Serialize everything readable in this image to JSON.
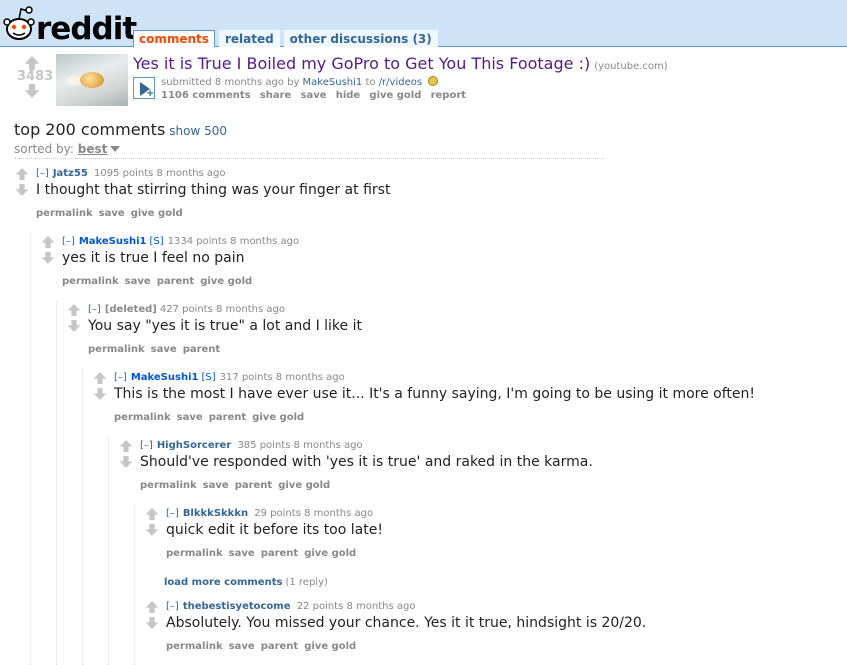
{
  "header": {
    "logo_text": "reddit",
    "tabs": [
      {
        "label": "comments",
        "selected": true
      },
      {
        "label": "related",
        "selected": false
      },
      {
        "label": "other discussions (3)",
        "selected": false
      }
    ]
  },
  "link": {
    "score": "3483",
    "title": "Yes it is True I Boiled my GoPro to Get You This Footage :)",
    "domain": "(youtube.com)",
    "submitted_prefix": "submitted 8 months ago by",
    "author": "MakeSushi1",
    "to": "to",
    "subreddit": "/r/videos",
    "buttons": [
      "1106 comments",
      "share",
      "save",
      "hide",
      "give gold",
      "report"
    ]
  },
  "comment_area": {
    "title": "top 200 comments",
    "show_more": "show 500",
    "sorted_label": "sorted by:",
    "sort_value": "best"
  },
  "comments": [
    {
      "author": "Jatz55",
      "flag": "",
      "score": "1095 points",
      "time": "8 months ago",
      "body": "I thought that stirring thing was your finger at first",
      "buttons": [
        "permalink",
        "save",
        "give gold"
      ]
    },
    {
      "author": "MakeSushi1",
      "flag": "[S]",
      "score": "1334 points",
      "time": "8 months ago",
      "body": "yes it is true I feel no pain",
      "buttons": [
        "permalink",
        "save",
        "parent",
        "give gold"
      ]
    },
    {
      "author": "[deleted]",
      "flag": "",
      "score": "427 points",
      "time": "8 months ago",
      "body": "You say \"yes it is true\" a lot and I like it",
      "buttons": [
        "permalink",
        "save",
        "parent"
      ]
    },
    {
      "author": "MakeSushi1",
      "flag": "[S]",
      "score": "317 points",
      "time": "8 months ago",
      "body": "This is the most I have ever use it... It's a funny saying, I'm going to be using it more often!",
      "buttons": [
        "permalink",
        "save",
        "parent",
        "give gold"
      ]
    },
    {
      "author": "HighSorcerer",
      "flag": "",
      "score": "385 points",
      "time": "8 months ago",
      "body": "Should've responded with 'yes it is true' and raked in the karma.",
      "buttons": [
        "permalink",
        "save",
        "parent",
        "give gold"
      ]
    },
    {
      "author": "BlkkkSkkkn",
      "flag": "",
      "score": "29 points",
      "time": "8 months ago",
      "body": "quick edit it before its too late!",
      "buttons": [
        "permalink",
        "save",
        "parent",
        "give gold"
      ]
    },
    {
      "author": "thebestisyetocome",
      "flag": "",
      "score": "22 points",
      "time": "8 months ago",
      "body": "Absolutely. You missed your chance. Yes it it true, hindsight is 20/20.",
      "buttons": [
        "permalink",
        "save",
        "parent",
        "give gold"
      ]
    }
  ],
  "load_more": {
    "label": "load more comments",
    "count": "(1 reply)"
  },
  "expand_label": "[–]"
}
